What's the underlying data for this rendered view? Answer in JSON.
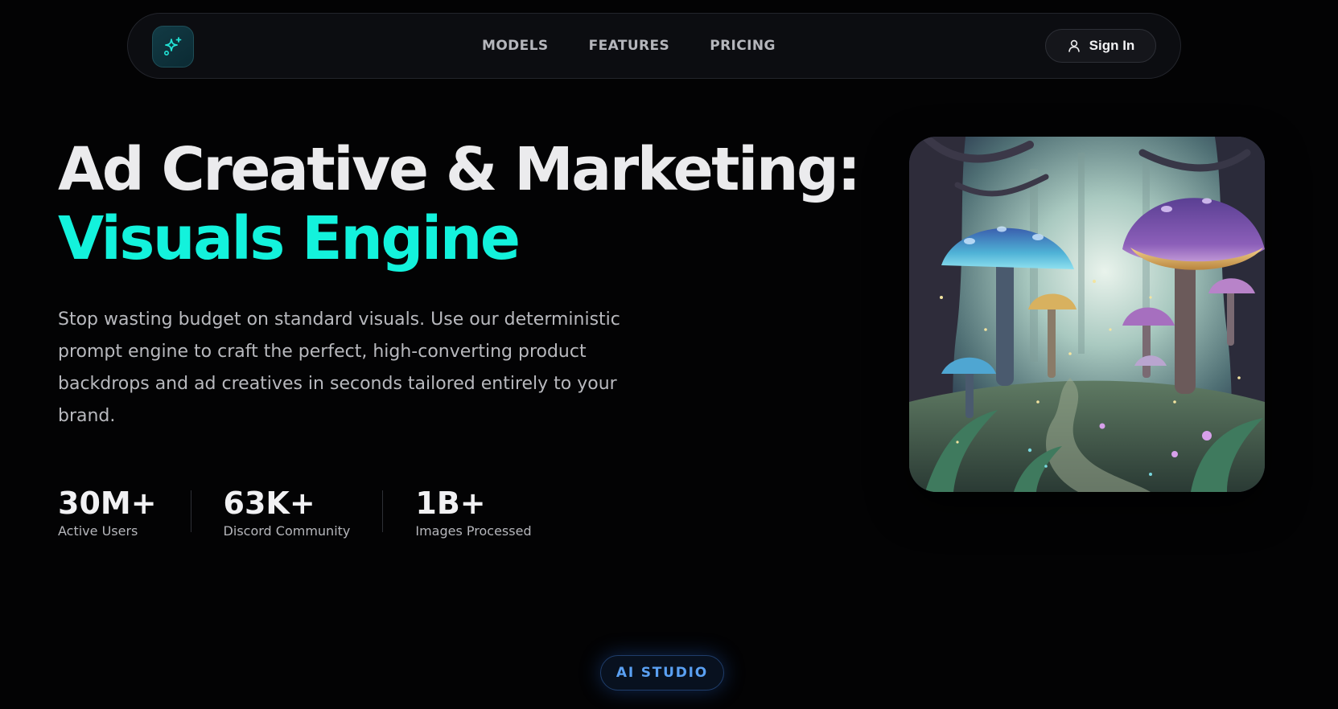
{
  "nav": {
    "logo_icon": "sparkles-icon",
    "links": [
      {
        "label": "MODELS"
      },
      {
        "label": "FEATURES"
      },
      {
        "label": "PRICING"
      }
    ],
    "signin": {
      "label": "Sign In",
      "icon": "user-icon"
    }
  },
  "hero": {
    "title_line1": "Ad Creative & Marketing:",
    "title_line2": "Visuals Engine",
    "description": "Stop wasting budget on standard visuals. Use our deterministic prompt engine to craft the perfect, high-converting product backdrops and ad creatives in seconds tailored entirely to your brand.",
    "stats": [
      {
        "value": "30M+",
        "label": "Active Users"
      },
      {
        "value": "63K+",
        "label": "Discord Community"
      },
      {
        "value": "1B+",
        "label": "Images Processed"
      }
    ],
    "image_subject": "enchanted-mushroom-forest-illustration"
  },
  "badge": {
    "label": "AI STUDIO"
  },
  "colors": {
    "background": "#030304",
    "accent": "#13f2dc",
    "badge_text": "#5aa0f2",
    "title": "#ebebed"
  }
}
